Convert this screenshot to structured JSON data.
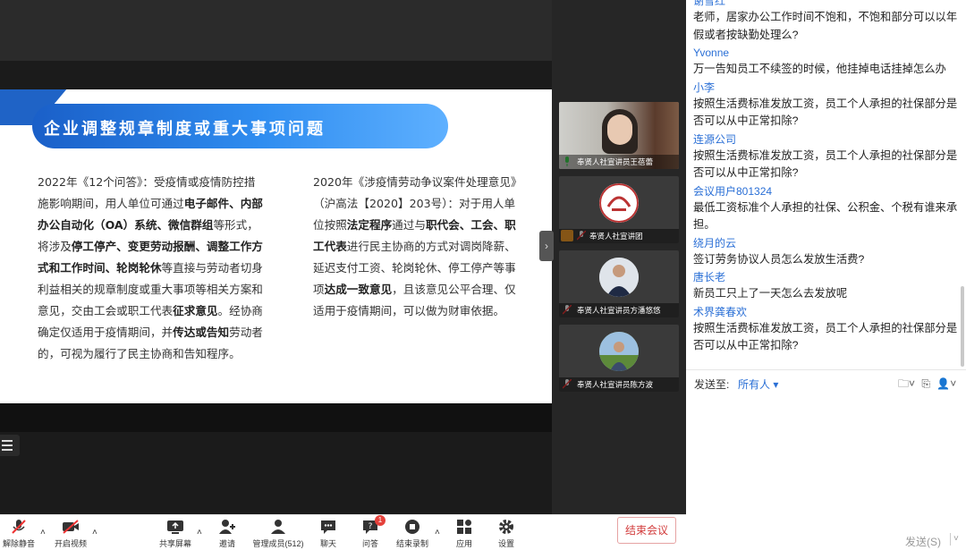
{
  "slide": {
    "title": "企业调整规章制度或重大事项问题",
    "left_column": [
      {
        "b": false,
        "t": "2022年《12个问答》"
      },
      {
        "b": false,
        "t": "：受疫情或疫情防控措施影响期间，用人单位可通过"
      },
      {
        "b": true,
        "t": "电子邮件、内部办公自动化（OA）系统、微信群组"
      },
      {
        "b": false,
        "t": "等形式，将涉及"
      },
      {
        "b": true,
        "t": "停工停产、变更劳动报酬、调整工作方式和工作时间、轮岗轮休"
      },
      {
        "b": false,
        "t": "等直接与劳动者切身利益相关的规章制度或重大事项等相关方案和意见，交由工会或职工代表"
      },
      {
        "b": true,
        "t": "征求意见"
      },
      {
        "b": false,
        "t": "。经协商确定仅适用于疫情期间，并"
      },
      {
        "b": true,
        "t": "传达或告知"
      },
      {
        "b": false,
        "t": "劳动者的，可视为履行了民主协商和告知程序。"
      }
    ],
    "right_column": [
      {
        "b": false,
        "t": "2020年《涉疫情劳动争议案件处理意见》（沪高法【2020】203号）：对于用人单位按照"
      },
      {
        "b": true,
        "t": "法定程序"
      },
      {
        "b": false,
        "t": "通过与"
      },
      {
        "b": true,
        "t": "职代会、工会、职工代表"
      },
      {
        "b": false,
        "t": "进行民主协商的方式对调岗降薪、延迟支付工资、轮岗轮休、停工停产等事项"
      },
      {
        "b": true,
        "t": "达成一致意见"
      },
      {
        "b": false,
        "t": "，且该意见公平合理、仅适用于疫情期间，可以做为财审依据。"
      }
    ]
  },
  "participants": [
    {
      "label": "奉贤人社宣讲员王蓓蕾"
    },
    {
      "label": "奉贤人社宣讲团"
    },
    {
      "label": "奉贤人社宣讲员方潘悠悠"
    },
    {
      "label": "奉贤人社宣讲员陈方波"
    }
  ],
  "chat": {
    "messages": [
      {
        "name": "谢雪红",
        "text": "老师，居家办公工作时间不饱和，不饱和部分可以以年假或者按缺勤处理么?"
      },
      {
        "name": "Yvonne",
        "text": "万一告知员工不续签的时候，他挂掉电话挂掉怎么办"
      },
      {
        "name": "小李",
        "text": "按照生活费标准发放工资，员工个人承担的社保部分是否可以从中正常扣除?"
      },
      {
        "name": "连源公司",
        "text": "按照生活费标准发放工资，员工个人承担的社保部分是否可以从中正常扣除?"
      },
      {
        "name": "会议用户801324",
        "text": "最低工资标准个人承担的社保、公积金、个税有谁来承担。"
      },
      {
        "name": "绕月的云",
        "text": "签订劳务协议人员怎么发放生活费?"
      },
      {
        "name": "唐长老",
        "text": "新员工只上了一天怎么去发放呢"
      },
      {
        "name": "术界龚春欢",
        "text": "按照生活费标准发放工资，员工个人承担的社保部分是否可以从中正常扣除?"
      }
    ],
    "send_to_label": "发送至:",
    "send_to_target": "所有人",
    "send_button": "发送(S)"
  },
  "toolbar": {
    "mute": "解除静音",
    "video": "开启视频",
    "share": "共享屏幕",
    "invite": "邀请",
    "members": "管理成员(512)",
    "chat": "聊天",
    "qa": "问答",
    "qa_badge": "1",
    "record": "结束录制",
    "apps": "应用",
    "settings": "设置",
    "end_meeting": "结束会议"
  }
}
